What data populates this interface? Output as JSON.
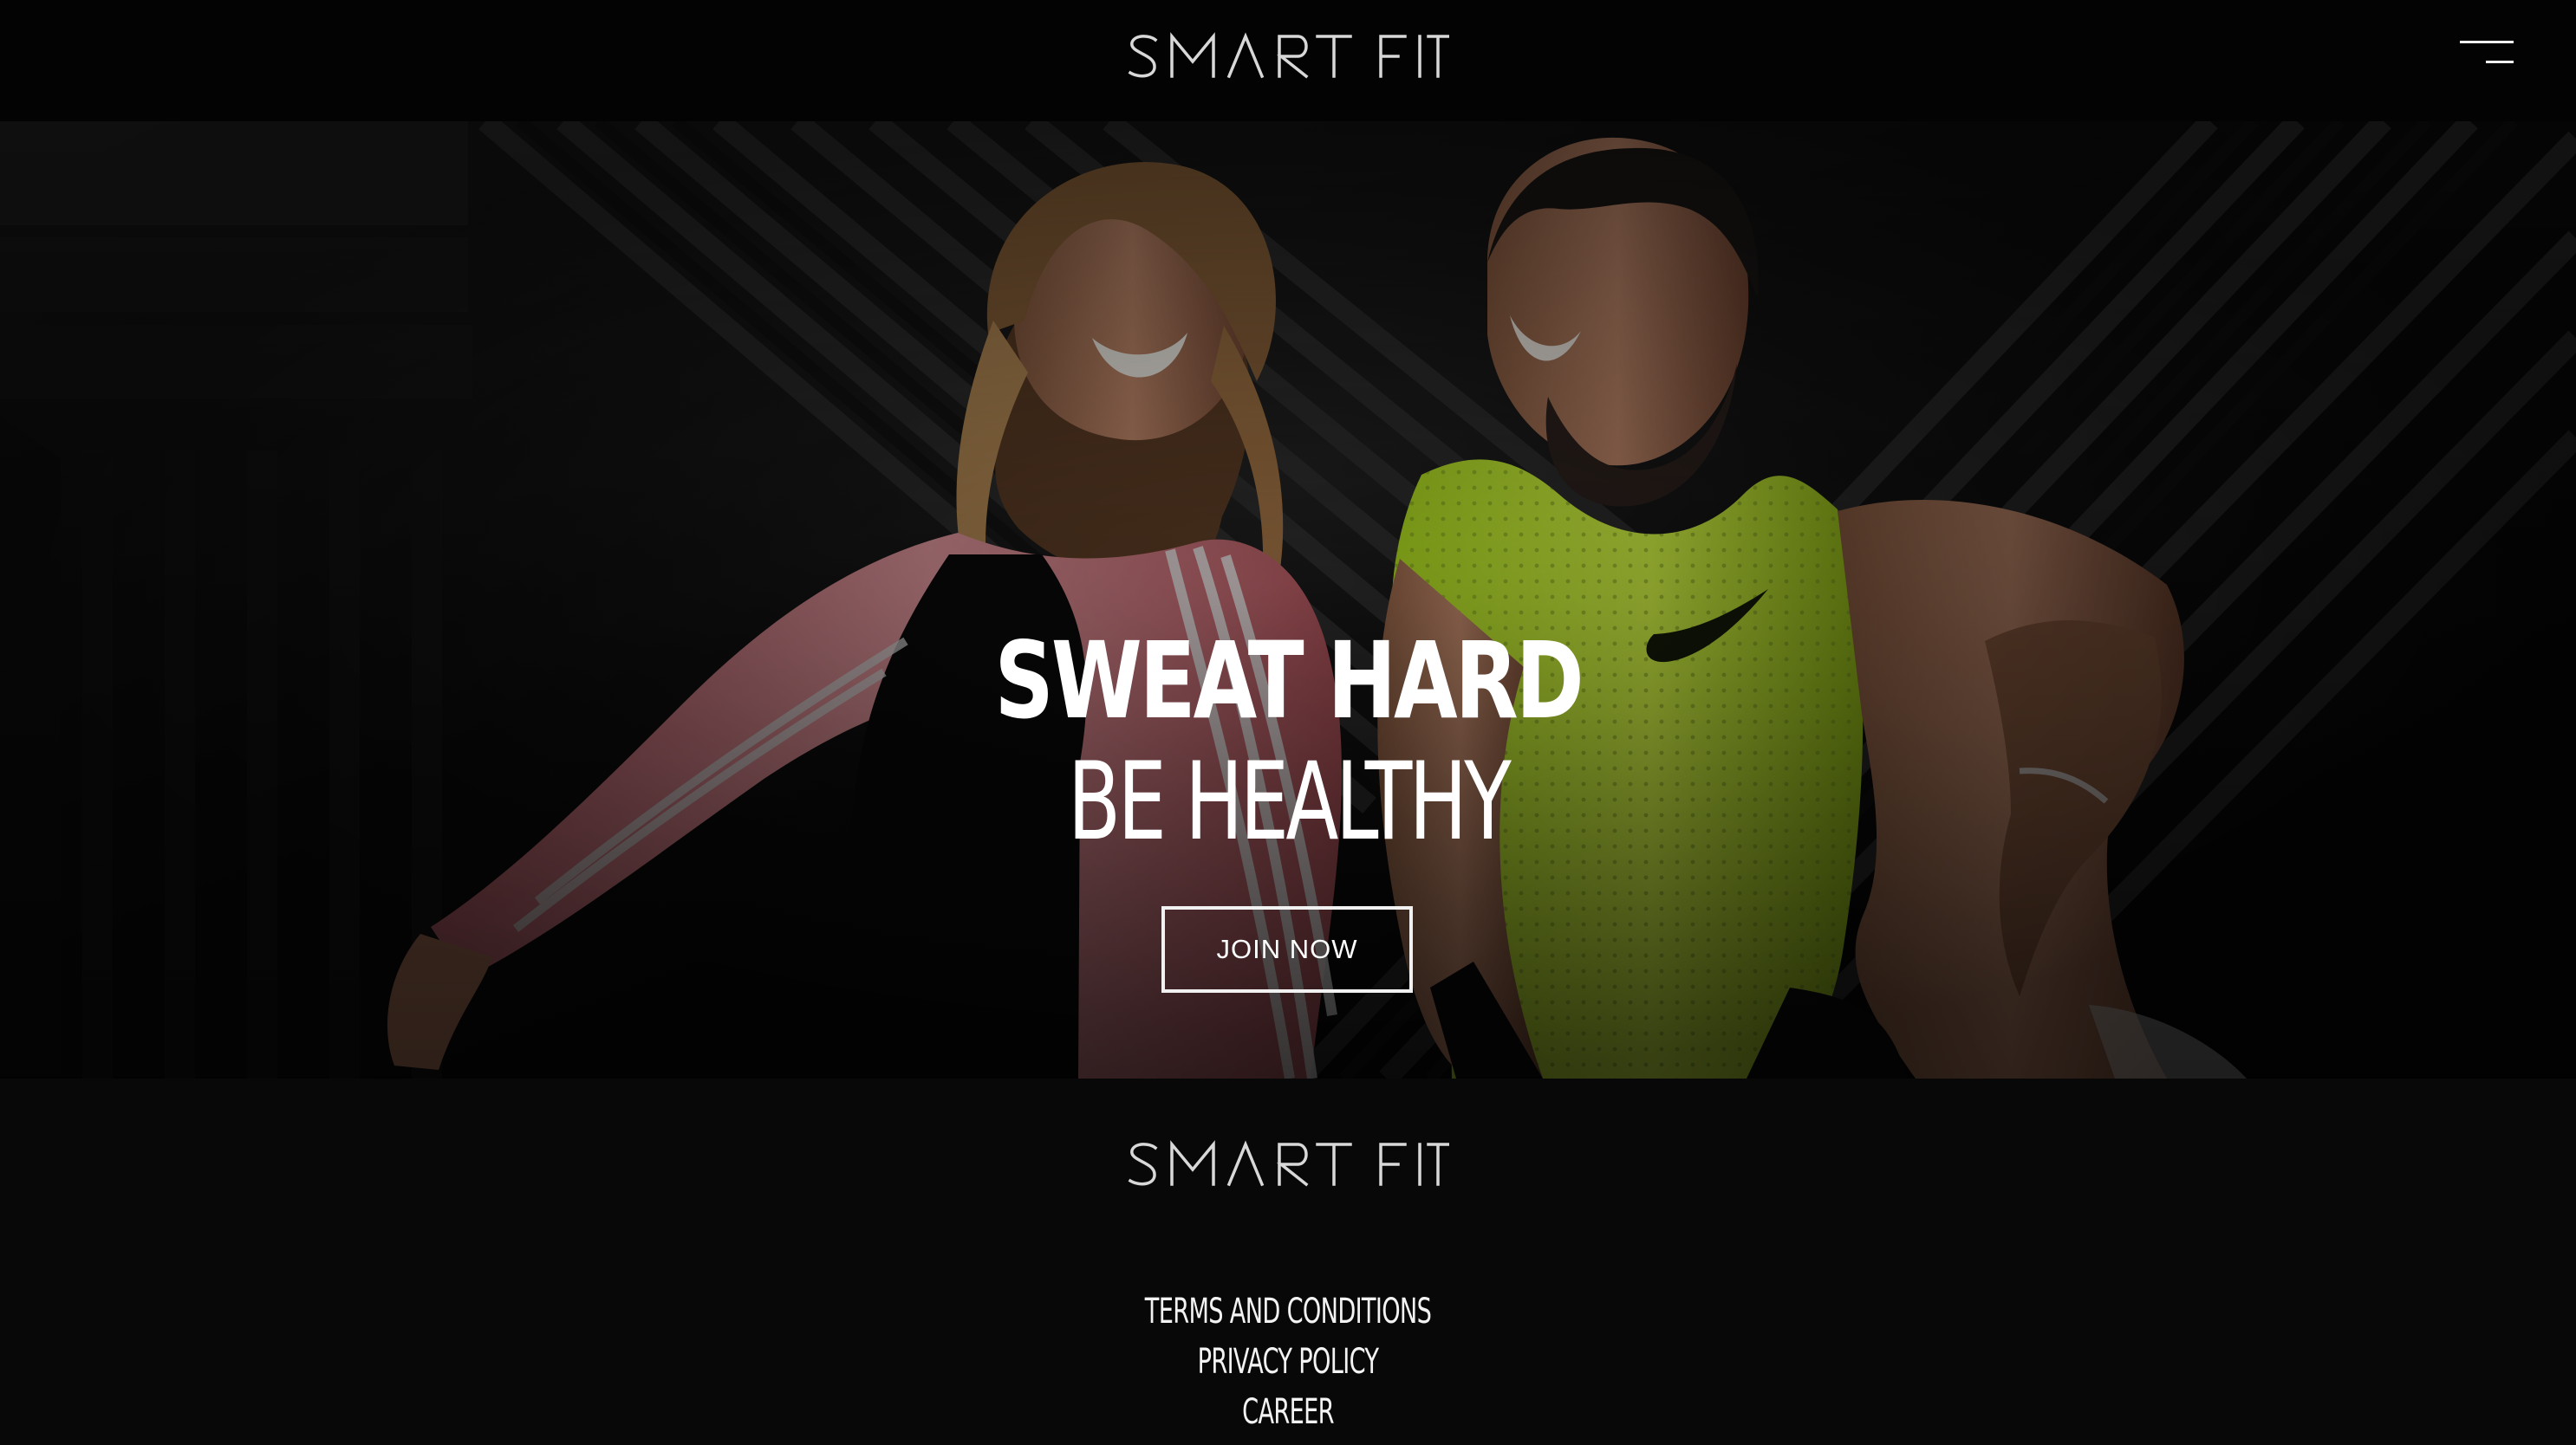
{
  "header": {
    "brand": "SMART FIT",
    "menu_icon": "hamburger-menu-icon"
  },
  "hero": {
    "title": "SWEAT HARD",
    "subtitle": "BE HEALTHY",
    "cta_label": "JOIN NOW"
  },
  "footer": {
    "brand": "SMART FIT",
    "links": [
      "TERMS AND CONDITIONS",
      "PRIVACY POLICY",
      "CAREER"
    ]
  },
  "colors": {
    "background": "#070707",
    "text": "#ffffff",
    "pink_jacket": "#d87a7f",
    "neon_shirt": "#c7ef2f"
  }
}
